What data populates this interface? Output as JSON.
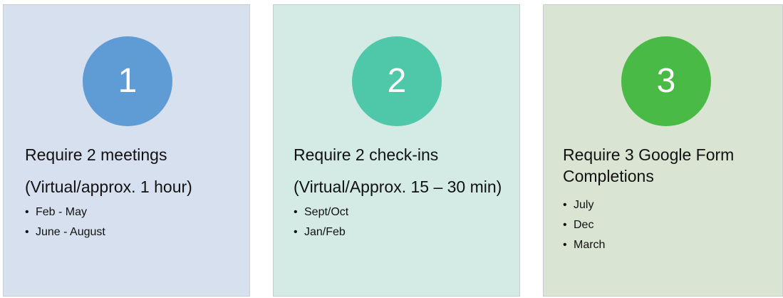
{
  "panels": [
    {
      "number": "1",
      "title": "Require 2 meetings",
      "subtitle": "(Virtual/approx. 1 hour)",
      "items": [
        "Feb - May",
        "June - August"
      ],
      "panel_color": "#d6e0ee",
      "circle_color": "#5f9bd5"
    },
    {
      "number": "2",
      "title": "Require 2 check-ins",
      "subtitle": "(Virtual/Approx. 15 – 30 min)",
      "items": [
        "Sept/Oct",
        "Jan/Feb"
      ],
      "panel_color": "#d3ebe4",
      "circle_color": "#4fc8aa"
    },
    {
      "number": "3",
      "title": "Require 3 Google Form Completions",
      "subtitle": "",
      "items": [
        "July",
        "Dec",
        "March"
      ],
      "panel_color": "#d9e4d3",
      "circle_color": "#4aba47"
    }
  ]
}
